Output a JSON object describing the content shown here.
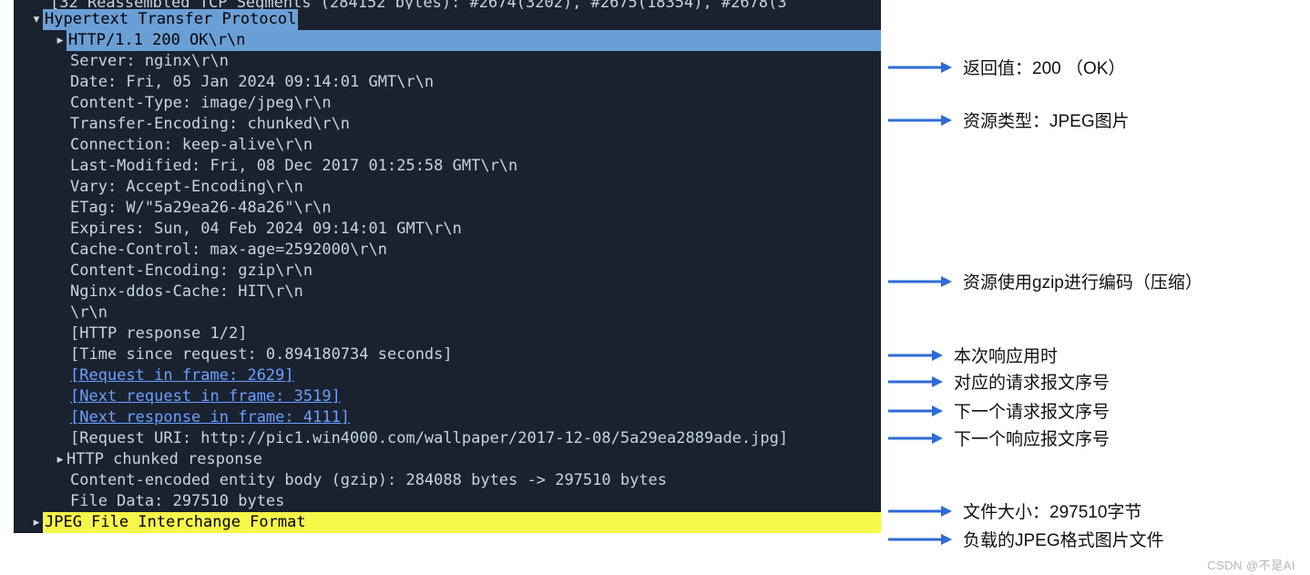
{
  "panel": {
    "truncated": "[32 Reassembled TCP Segments (284152 bytes): #2674(3202), #2675(18354), #2678(3",
    "hdr_http": "Hypertext Transfer Protocol",
    "status_line": "HTTP/1.1 200 OK\\r\\n",
    "headers": [
      "Server: nginx\\r\\n",
      "Date: Fri, 05 Jan 2024 09:14:01 GMT\\r\\n",
      "Content-Type: image/jpeg\\r\\n",
      "Transfer-Encoding: chunked\\r\\n",
      "Connection: keep-alive\\r\\n",
      "Last-Modified: Fri, 08 Dec 2017 01:25:58 GMT\\r\\n",
      "Vary: Accept-Encoding\\r\\n",
      "ETag: W/\"5a29ea26-48a26\"\\r\\n",
      "Expires: Sun, 04 Feb 2024 09:14:01 GMT\\r\\n",
      "Cache-Control: max-age=2592000\\r\\n",
      "Content-Encoding: gzip\\r\\n",
      "Nginx-ddos-Cache: HIT\\r\\n",
      "\\r\\n"
    ],
    "meta": [
      {
        "text": "[HTTP response 1/2]",
        "link": false
      },
      {
        "text": "[Time since request: 0.894180734 seconds]",
        "link": false
      },
      {
        "text": "[Request in frame: 2629]",
        "link": true
      },
      {
        "text": "[Next request in frame: 3519]",
        "link": true
      },
      {
        "text": "[Next response in frame: 4111]",
        "link": true
      },
      {
        "text": "[Request URI: http://pic1.win4000.com/wallpaper/2017-12-08/5a29ea2889ade.jpg]",
        "link": false
      }
    ],
    "chunked": "HTTP chunked response",
    "entity": "Content-encoded entity body (gzip): 284088 bytes -> 297510 bytes",
    "file_data": "File Data: 297510 bytes",
    "jpeg": "JPEG File Interchange Format"
  },
  "annos": {
    "a1": "返回值：200 （OK）",
    "a2": "资源类型：JPEG图片",
    "a3": "资源使用gzip进行编码（压缩）",
    "a4": "本次响应用时",
    "a5": "对应的请求报文序号",
    "a6": "下一个请求报文序号",
    "a7": "下一个响应报文序号",
    "a8": "文件大小：297510字节",
    "a9": "负载的JPEG格式图片文件"
  },
  "watermark": "CSDN @不是AI"
}
